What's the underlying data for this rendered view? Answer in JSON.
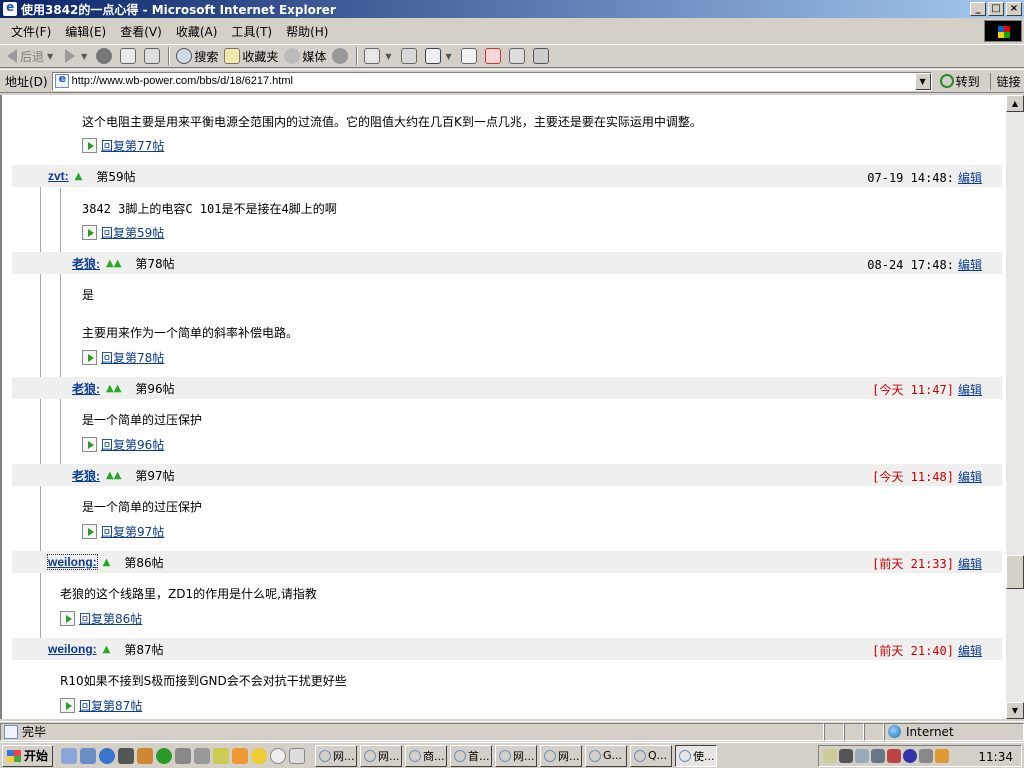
{
  "window": {
    "title": "使用3842的一点心得 - Microsoft Internet Explorer",
    "buttons": {
      "minimize": "_",
      "maximize": "□",
      "close": "×"
    }
  },
  "menu": [
    "文件(F)",
    "编辑(E)",
    "查看(V)",
    "收藏(A)",
    "工具(T)",
    "帮助(H)"
  ],
  "toolbar": {
    "back": "后退",
    "search": "搜索",
    "favorites": "收藏夹",
    "media": "媒体"
  },
  "address": {
    "label": "地址(D)",
    "url": "http://www.wb-power.com/bbs/d/18/6217.html",
    "go": "转到",
    "links": "链接"
  },
  "posts": [
    {
      "type": "body",
      "text": "这个电阻主要是用来平衡电源全范围内的过流值。它的阻值大约在几百K到一点几兆，主要还是要在实际运用中调整。"
    },
    {
      "type": "reply",
      "text": "回复第77帖"
    },
    {
      "type": "header",
      "author": "zvt:",
      "tri": "▲",
      "postno": "第59帖",
      "time": "07-19 14:48:",
      "edit": "编辑"
    },
    {
      "type": "body",
      "text": "3842  3脚上的电容C 101是不是接在4脚上的啊"
    },
    {
      "type": "reply",
      "text": "回复第59帖"
    },
    {
      "type": "header",
      "author": "老狼:",
      "tri": "▲▲",
      "postno": "第78帖",
      "time": "08-24 17:48:",
      "edit": "编辑"
    },
    {
      "type": "body",
      "text": "是"
    },
    {
      "type": "body",
      "text": "主要用来作为一个简单的斜率补偿电路。"
    },
    {
      "type": "reply",
      "text": "回复第78帖"
    },
    {
      "type": "header",
      "author": "老狼:",
      "tri": "▲▲",
      "postno": "第96帖",
      "time_prefix": "[今天",
      "time_suffix": " 11:47]",
      "edit": "编辑"
    },
    {
      "type": "body",
      "text": "是一个简单的过压保护"
    },
    {
      "type": "reply",
      "text": "回复第96帖"
    },
    {
      "type": "header",
      "author": "老狼:",
      "tri": "▲▲",
      "postno": "第97帖",
      "time_prefix": "[今天",
      "time_suffix": " 11:48]",
      "edit": "编辑"
    },
    {
      "type": "body",
      "text": "是一个简单的过压保护"
    },
    {
      "type": "reply",
      "text": "回复第97帖"
    },
    {
      "type": "header",
      "author": "weilong:",
      "tri": "▲",
      "postno": "第86帖",
      "time_prefix": "[前天",
      "time_suffix": " 21:33]",
      "edit": "编辑"
    },
    {
      "type": "body",
      "text": "老狼的这个线路里，ZD1的作用是什么呢,请指教"
    },
    {
      "type": "reply",
      "text": "回复第86帖"
    },
    {
      "type": "header",
      "author": "weilong:",
      "tri": "▲",
      "postno": "第87帖",
      "time_prefix": "[前天",
      "time_suffix": " 21:40]",
      "edit": "编辑"
    },
    {
      "type": "body",
      "text": "R10如果不接到S极而接到GND会不会对抗干扰更好些"
    },
    {
      "type": "reply",
      "text": "回复第87帖"
    }
  ],
  "status": {
    "text": "完毕",
    "zone": "Internet"
  },
  "taskbar": {
    "start": "开始",
    "tasks": [
      "网...",
      "网...",
      "商...",
      "首...",
      "网...",
      "网...",
      "G...",
      "Q...",
      "使..."
    ],
    "clock": "11:34"
  },
  "colors": {
    "link": "#0b3d91",
    "red": "#cc0000",
    "green": "#22aa22",
    "header_bg": "#efefef"
  }
}
